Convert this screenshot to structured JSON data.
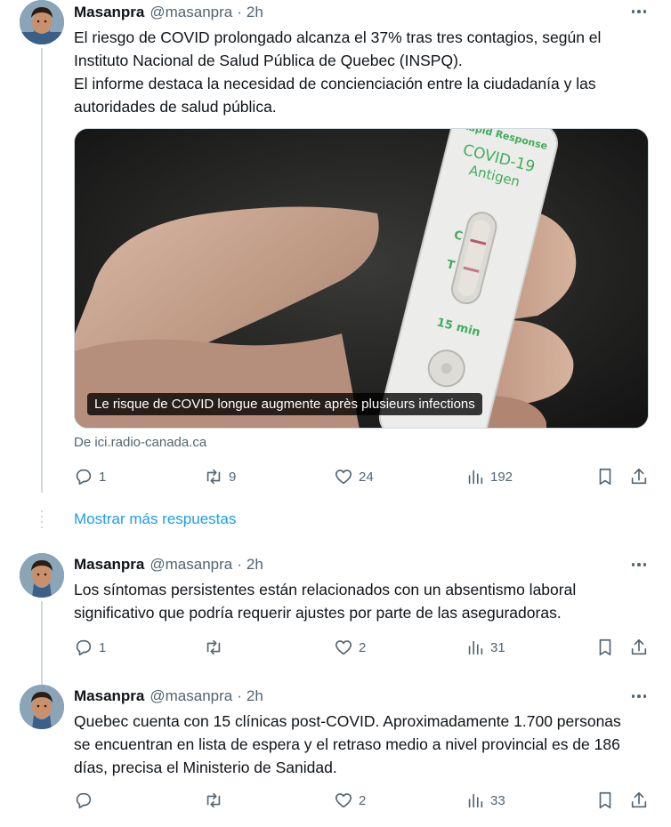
{
  "tweets": [
    {
      "name": "Masanpra",
      "handle": "@masanpra",
      "dot": "·",
      "time": "2h",
      "text_lines": [
        "El riesgo de COVID prolongado alcanza el 37% tras tres contagios, según el",
        "Instituto Nacional de Salud Pública de Quebec (INSPQ).",
        "El informe destaca la necesidad de concienciación entre la ciudadanía y las",
        "autoridades de salud pública."
      ],
      "media": {
        "caption": "Le risque de COVID longue augmente après plusieurs infections",
        "test_brand": "Rapid Response",
        "test_title1": "COVID-19",
        "test_title2": "Antigen",
        "label_c": "C",
        "label_t": "T",
        "label_time": "15 min"
      },
      "source": "De ici.radio-canada.ca",
      "replies": "1",
      "retweets": "9",
      "likes": "24",
      "views": "192"
    },
    {
      "name": "Masanpra",
      "handle": "@masanpra",
      "dot": "·",
      "time": "2h",
      "text_lines": [
        "Los síntomas persistentes están relacionados con un absentismo laboral",
        "significativo que podría requerir ajustes por parte de las aseguradoras."
      ],
      "replies": "1",
      "retweets": "",
      "likes": "2",
      "views": "31"
    },
    {
      "name": "Masanpra",
      "handle": "@masanpra",
      "dot": "·",
      "time": "2h",
      "text_lines": [
        "Quebec cuenta con 15 clínicas post-COVID. Aproximadamente 1.700 personas",
        "se encuentran en lista de espera y el retraso medio a nivel provincial es de 186",
        "días, precisa el Ministerio de Sanidad."
      ],
      "replies": "",
      "retweets": "",
      "likes": "2",
      "views": "33"
    }
  ],
  "show_more": "Mostrar más respuestas",
  "icons": {
    "reply": "reply-icon",
    "retweet": "retweet-icon",
    "like": "heart-icon",
    "views": "views-icon",
    "bookmark": "bookmark-icon",
    "share": "share-icon",
    "more": "more-icon"
  },
  "colors": {
    "link": "#1d9bf0",
    "secondary": "#536471",
    "primary": "#0f1419"
  }
}
